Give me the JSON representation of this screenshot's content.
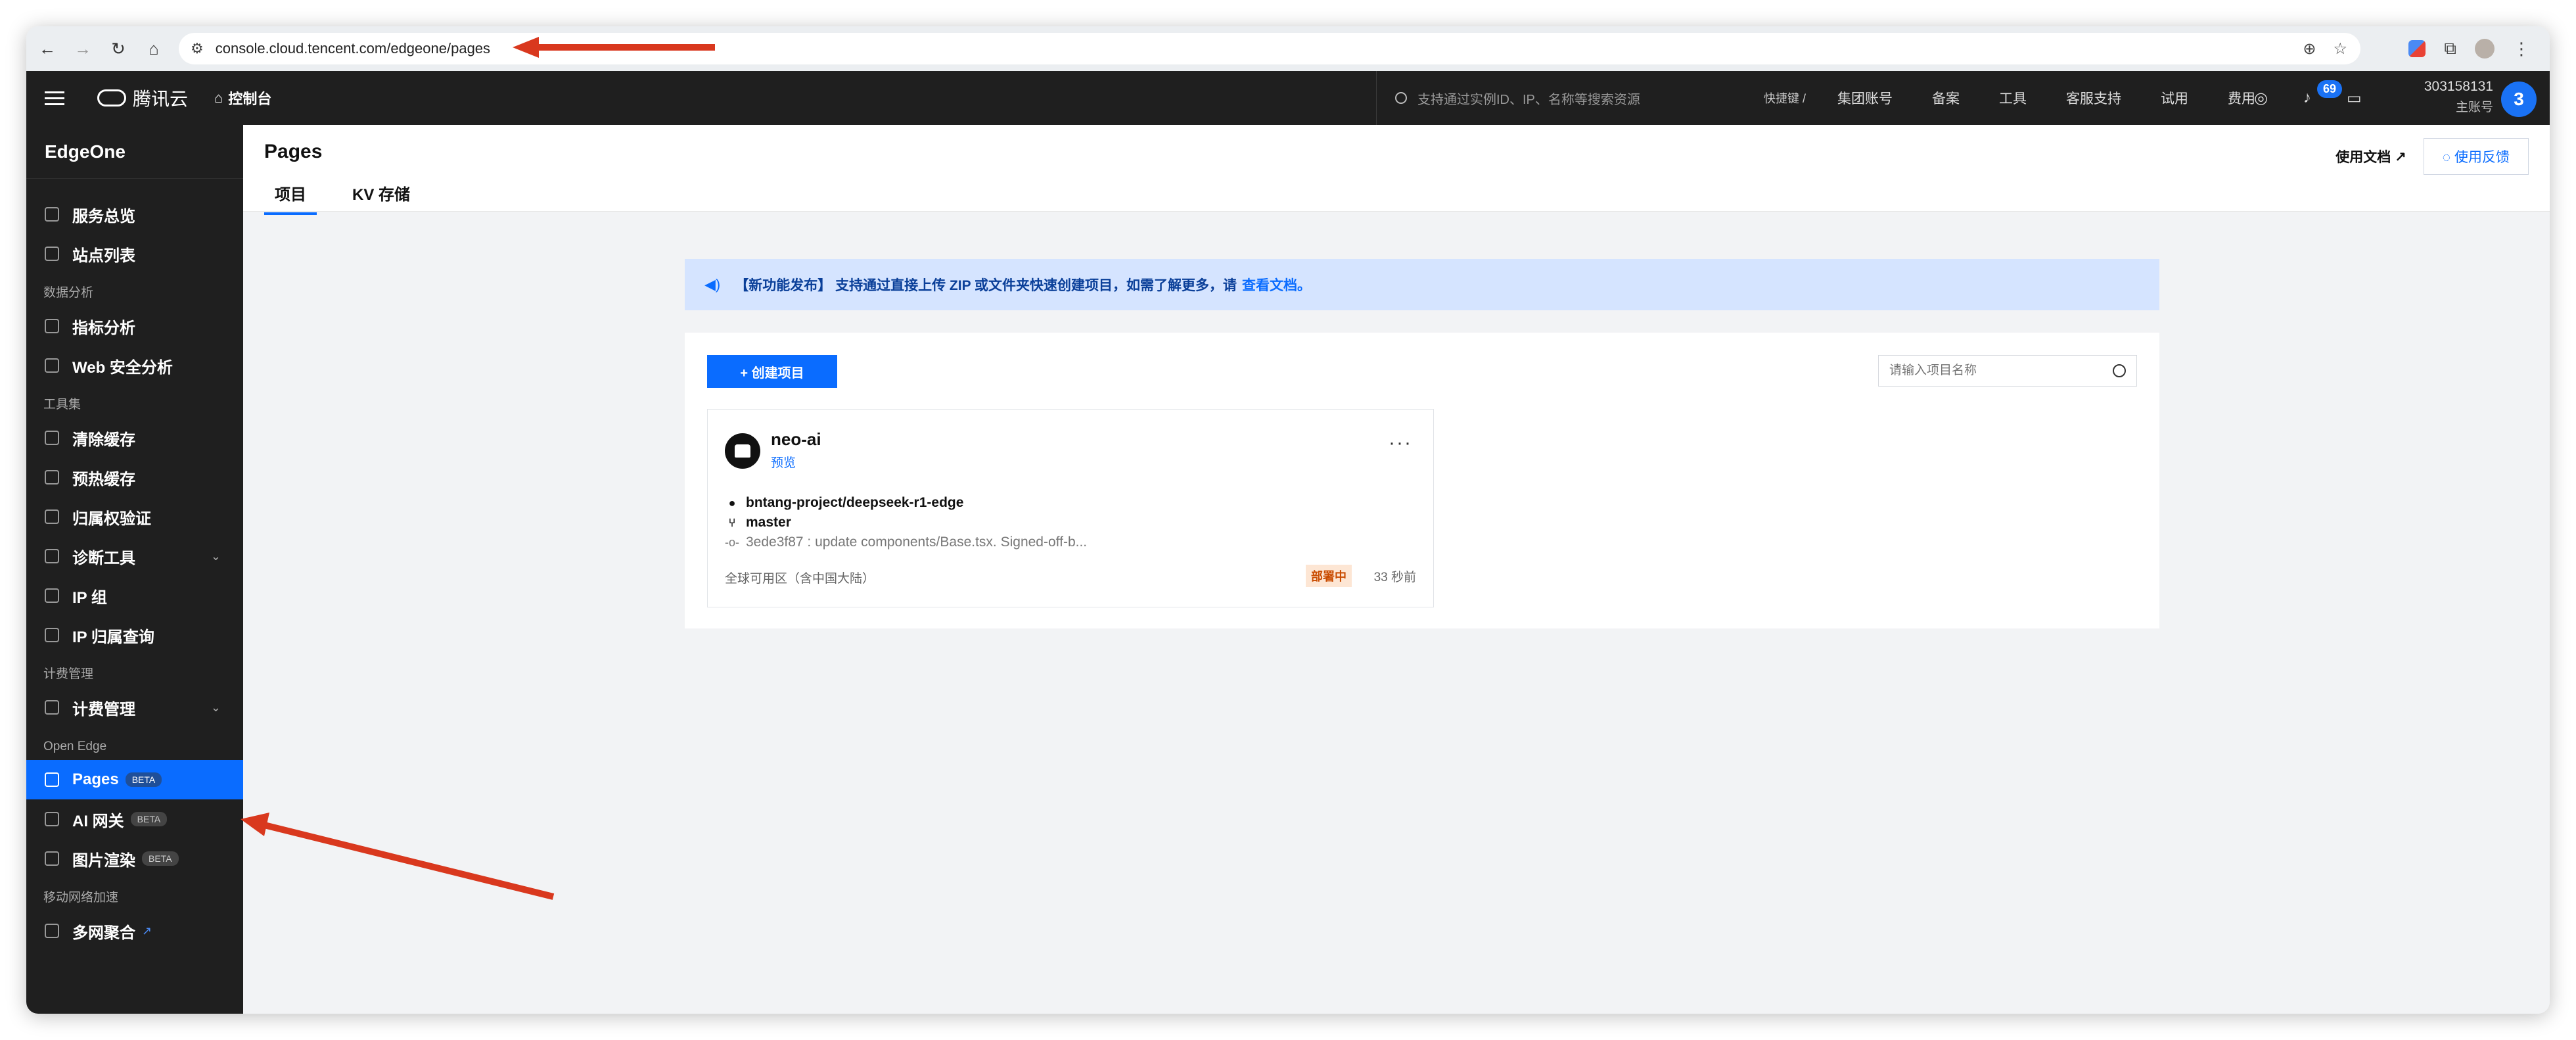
{
  "browser": {
    "url": "console.cloud.tencent.com/edgeone/pages"
  },
  "topbar": {
    "brand": "腾讯云",
    "console": "控制台",
    "search_placeholder": "支持通过实例ID、IP、名称等搜索资源",
    "search_shortcut": "快捷键 /",
    "links": [
      "集团账号",
      "备案",
      "工具",
      "客服支持",
      "试用",
      "费用"
    ],
    "notification_count": "69",
    "account_id": "303158131",
    "account_role": "主账号",
    "avatar_letter": "3"
  },
  "sidebar": {
    "title": "EdgeOne",
    "items": [
      {
        "type": "item",
        "label": "服务总览",
        "icon": "grid-icon"
      },
      {
        "type": "item",
        "label": "站点列表",
        "icon": "list-icon"
      },
      {
        "type": "group",
        "label": "数据分析"
      },
      {
        "type": "item",
        "label": "指标分析",
        "icon": "chart-icon"
      },
      {
        "type": "item",
        "label": "Web 安全分析",
        "icon": "shield-icon"
      },
      {
        "type": "group",
        "label": "工具集"
      },
      {
        "type": "item",
        "label": "清除缓存",
        "icon": "clear-cache-icon"
      },
      {
        "type": "item",
        "label": "预热缓存",
        "icon": "prefetch-icon"
      },
      {
        "type": "item",
        "label": "归属权验证",
        "icon": "verify-icon"
      },
      {
        "type": "item",
        "label": "诊断工具",
        "icon": "diagnose-icon",
        "chevron": true
      },
      {
        "type": "item",
        "label": "IP 组",
        "icon": "ip-group-icon"
      },
      {
        "type": "item",
        "label": "IP 归属查询",
        "icon": "ip-lookup-icon"
      },
      {
        "type": "group",
        "label": "计费管理"
      },
      {
        "type": "item",
        "label": "计费管理",
        "icon": "billing-icon",
        "chevron": true
      },
      {
        "type": "group",
        "label": "Open Edge"
      },
      {
        "type": "item",
        "label": "Pages",
        "icon": "pages-icon",
        "badge": "BETA",
        "active": true
      },
      {
        "type": "item",
        "label": "AI 网关",
        "icon": "ai-gateway-icon",
        "badge": "BETA"
      },
      {
        "type": "item",
        "label": "图片渲染",
        "icon": "image-render-icon",
        "badge": "BETA"
      },
      {
        "type": "group",
        "label": "移动网络加速"
      },
      {
        "type": "item",
        "label": "多网聚合",
        "icon": "multi-network-icon",
        "external": true
      }
    ]
  },
  "content": {
    "title": "Pages",
    "tabs": [
      {
        "label": "项目",
        "active": true
      },
      {
        "label": "KV 存储",
        "active": false
      }
    ],
    "doc_link": "使用文档",
    "feedback": "使用反馈",
    "notice": {
      "text": "【新功能发布】 支持通过直接上传 ZIP 或文件夹快速创建项目，如需了解更多，请",
      "link": "查看文档。"
    },
    "create_button": "+ 创建项目",
    "search_placeholder": "请输入项目名称",
    "project": {
      "name": "neo-ai",
      "preview": "预览",
      "repo": "bntang-project/deepseek-r1-edge",
      "branch": "master",
      "commit": "3ede3f87 : update components/Base.tsx. Signed-off-b...",
      "region": "全球可用区（含中国大陆）",
      "status": "部署中",
      "time_ago": "33 秒前"
    }
  },
  "colors": {
    "accent": "#0a6cff",
    "sidebar_bg": "#1f1f1f",
    "annotation_arrow": "#d9381e"
  }
}
